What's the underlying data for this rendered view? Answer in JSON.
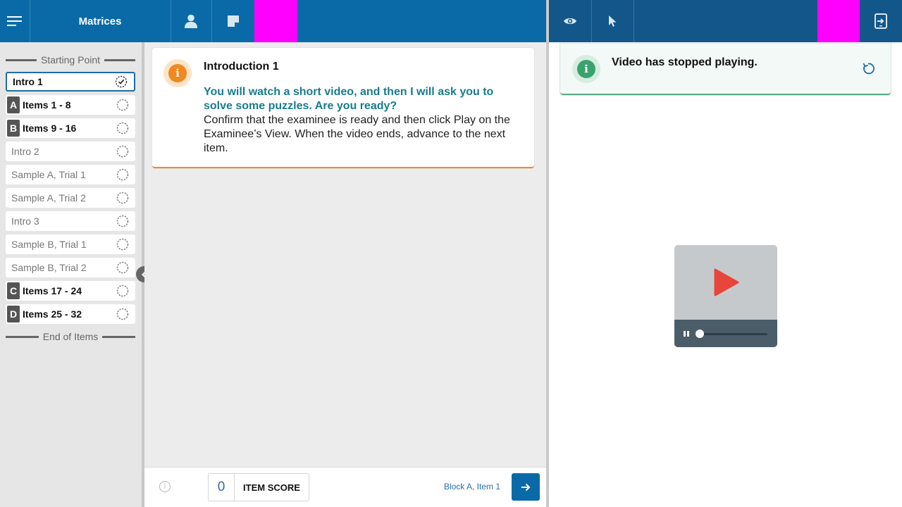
{
  "header": {
    "title": "Matrices",
    "accent_color": "#0a6aa8",
    "right_bar_color": "#13568a",
    "menu_icon": "hamburger-menu-icon",
    "user_icon": "person-icon",
    "notes_icon": "note-icon",
    "eye_icon": "eye-icon",
    "pointer_icon": "cursor-pointer-icon",
    "switch_icon": "device-switch-icon"
  },
  "sidebar": {
    "start_label": "Starting Point",
    "end_label": "End of Items",
    "items": [
      {
        "letter": "",
        "label": "Intro 1",
        "selected": true,
        "status_icon": "check-circle-icon"
      },
      {
        "letter": "A",
        "label": "Items 1 - 8",
        "status_icon": "dashed-circle-icon"
      },
      {
        "letter": "B",
        "label": "Items 9 - 16",
        "status_icon": "dashed-circle-icon"
      },
      {
        "letter": "",
        "label": "Intro 2",
        "status_icon": "dashed-circle-icon"
      },
      {
        "letter": "",
        "label": "Sample A, Trial 1",
        "status_icon": "dashed-circle-icon"
      },
      {
        "letter": "",
        "label": "Sample A, Trial 2",
        "status_icon": "dashed-circle-icon"
      },
      {
        "letter": "",
        "label": "Intro 3",
        "status_icon": "dashed-circle-icon"
      },
      {
        "letter": "",
        "label": "Sample B, Trial 1",
        "status_icon": "dashed-circle-icon"
      },
      {
        "letter": "",
        "label": "Sample B, Trial 2",
        "status_icon": "dashed-circle-icon"
      },
      {
        "letter": "C",
        "label": "Items 17 - 24",
        "status_icon": "dashed-circle-icon"
      },
      {
        "letter": "D",
        "label": "Items 25 - 32",
        "status_icon": "dashed-circle-icon"
      }
    ]
  },
  "card": {
    "icon_letter": "i",
    "title": "Introduction 1",
    "prompt": "You will watch a short video, and then I will ask you to solve some puzzles. Are you ready?",
    "body": "Confirm that the examinee is ready and then click Play on the Examinee’s View. When the video ends, advance to the next item.",
    "accent_color": "#f0891e",
    "prompt_color": "#1a7b8c"
  },
  "footer": {
    "info_icon_letter": "i",
    "item_score_value": "0",
    "item_score_label": "ITEM SCORE",
    "position_text": "Block A, Item 1",
    "next_icon": "arrow-right-icon"
  },
  "notice": {
    "icon_letter": "i",
    "message": "Video has stopped playing.",
    "replay_icon": "replay-icon",
    "accent_color": "#3aa26e"
  },
  "video": {
    "play_icon": "play-icon",
    "pause_icon": "pause-icon",
    "progress": 0.06,
    "play_color": "#e8453c"
  }
}
